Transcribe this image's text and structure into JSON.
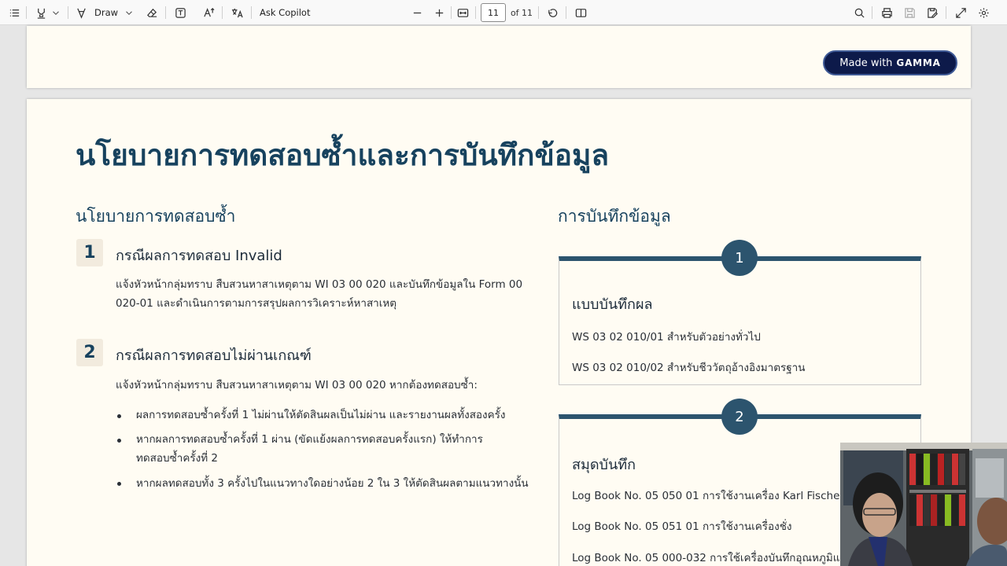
{
  "toolbar": {
    "draw_label": "Draw",
    "ask_copilot_label": "Ask Copilot",
    "page_current": "11",
    "page_total": "of 11"
  },
  "badge": {
    "made_with": "Made with",
    "brand": "GAMMA"
  },
  "slide": {
    "title": "นโยบายการทดสอบซ้ำและการบันทึกข้อมูล",
    "left_heading": "นโยบายการทดสอบซ้ำ",
    "right_heading": "การบันทึกข้อมูล",
    "cases": [
      {
        "number": "1",
        "title": "กรณีผลการทดสอบ Invalid",
        "body": "แจ้งหัวหน้ากลุ่มทราบ สืบสวนหาสาเหตุตาม WI 03 00 020 และบันทึกข้อมูลใน Form 00 020-01 และดำเนินการตามการสรุปผลการวิเคราะห์หาสาเหตุ"
      },
      {
        "number": "2",
        "title": "กรณีผลการทดสอบไม่ผ่านเกณฑ์",
        "body": "แจ้งหัวหน้ากลุ่มทราบ สืบสวนหาสาเหตุตาม WI 03 00 020 หากต้องทดสอบซ้ำ:",
        "bullets": [
          "ผลการทดสอบซ้ำครั้งที่ 1 ไม่ผ่านให้ตัดสินผลเป็นไม่ผ่าน และรายงานผลทั้งสองครั้ง",
          "หากผลการทดสอบซ้ำครั้งที่ 1 ผ่าน (ขัดแย้งผลการทดสอบครั้งแรก) ให้ทำการทดสอบซ้ำครั้งที่ 2",
          "หากผลทดสอบทั้ง 3 ครั้งไปในแนวทางใดอย่างน้อย 2 ใน 3 ให้ตัดสินผลตามแนวทางนั้น"
        ]
      }
    ],
    "cards": [
      {
        "number": "1",
        "title": "แบบบันทึกผล",
        "lines": [
          "WS 03 02 010/01 สำหรับตัวอย่างทั่วไป",
          "WS 03 02 010/02 สำหรับชีววัตถุอ้างอิงมาตรฐาน"
        ]
      },
      {
        "number": "2",
        "title": "สมุดบันทึก",
        "lines": [
          "Log Book No. 05 050 01 การใช้งานเครื่อง Karl Fischer",
          "Log Book No. 05 051 01 การใช้งานเครื่องชั่ง",
          "Log Book No. 05 000-032 การใช้เครื่องบันทึกอุณหภูมิแล"
        ]
      }
    ]
  },
  "colors": {
    "page_bg": "#fffcf3",
    "heading": "#17425e",
    "accent": "#2c546e",
    "badge_bg": "#0d1a4a"
  }
}
